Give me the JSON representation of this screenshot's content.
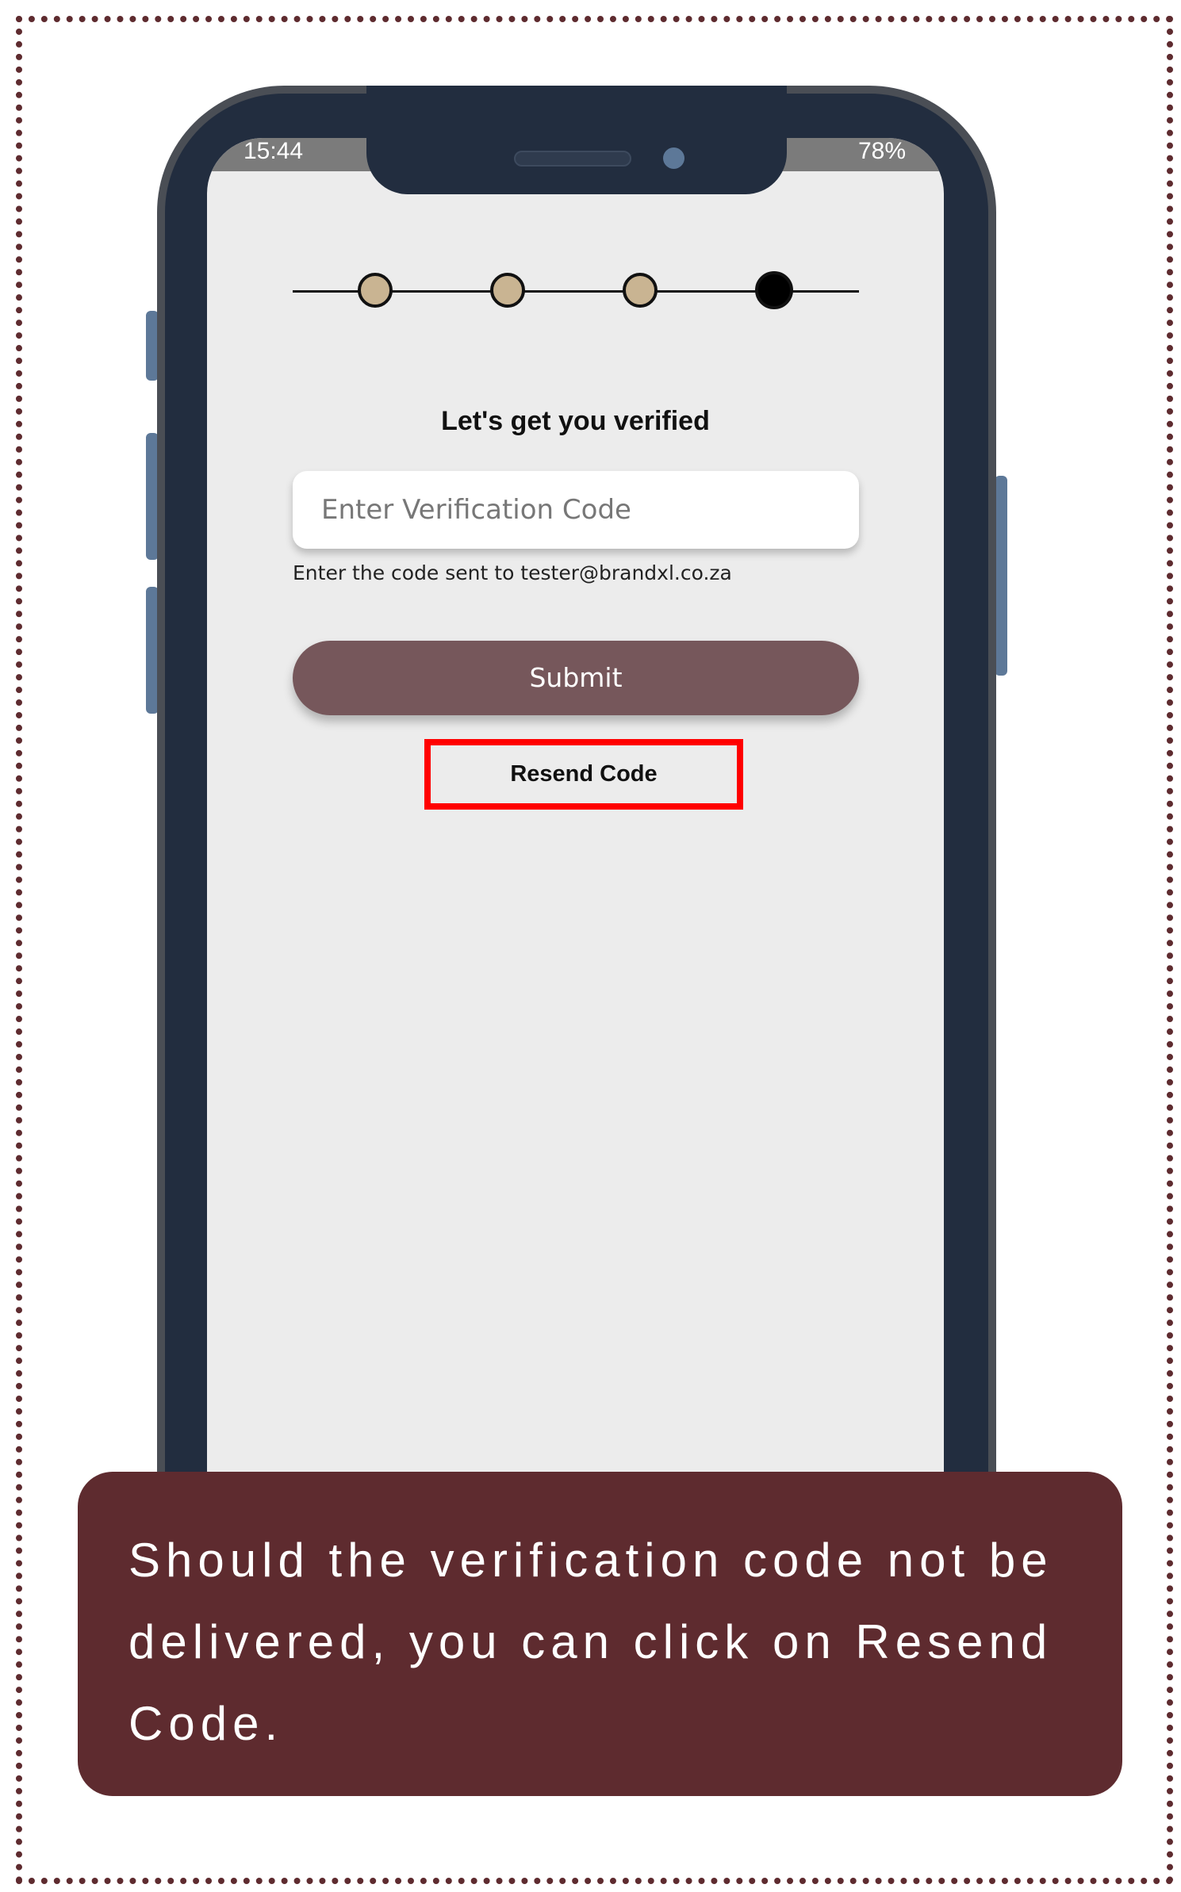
{
  "status_bar": {
    "time": "15:44",
    "right": "78%",
    "icons": [
      "gallery-icon",
      "signal-icon",
      "battery-icon"
    ]
  },
  "stepper": {
    "total_steps": 4,
    "current_step": 4,
    "completed_color": "#c9b492",
    "active_color": "#000000"
  },
  "verify": {
    "title": "Let's get you verified",
    "code_placeholder": "Enter Verification Code",
    "code_value": "",
    "helper_text": "Enter the code sent to tester@brandxl.co.za",
    "submit_label": "Submit",
    "resend_label": "Resend Code"
  },
  "caption": {
    "text": "Should the verification code not be delivered, you can click on Resend Code."
  },
  "colors": {
    "accent": "#5e2b2f",
    "submit_button": "#76575b",
    "highlight": "#ff0000",
    "phone_body": "#222d3f"
  }
}
